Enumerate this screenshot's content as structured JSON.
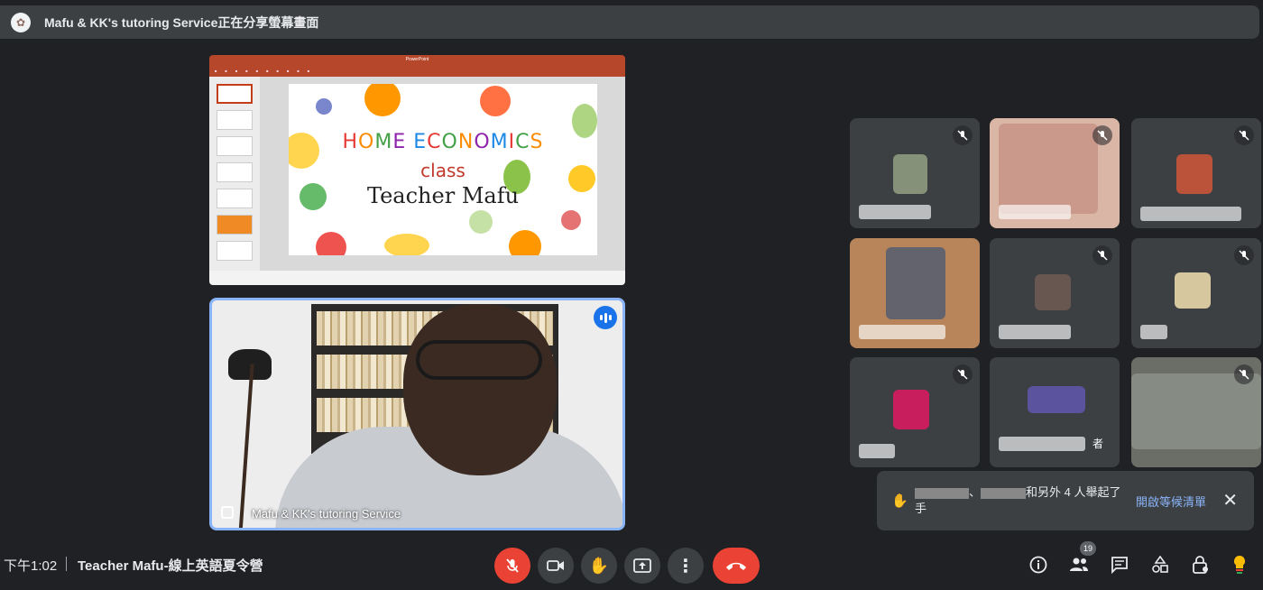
{
  "banner": {
    "text": "Mafu & KK's tutoring Service正在分享螢幕畫面"
  },
  "presentation": {
    "title_letters": [
      {
        "ch": "H",
        "color": "#e53935"
      },
      {
        "ch": "O",
        "color": "#fb8c00"
      },
      {
        "ch": "M",
        "color": "#43a047"
      },
      {
        "ch": "E",
        "color": "#8e24aa"
      },
      {
        "ch": " ",
        "color": "#000"
      },
      {
        "ch": "E",
        "color": "#1e88e5"
      },
      {
        "ch": "C",
        "color": "#e53935"
      },
      {
        "ch": "O",
        "color": "#43a047"
      },
      {
        "ch": "N",
        "color": "#fb8c00"
      },
      {
        "ch": "O",
        "color": "#8e24aa"
      },
      {
        "ch": "M",
        "color": "#1e88e5"
      },
      {
        "ch": "I",
        "color": "#e53935"
      },
      {
        "ch": "C",
        "color": "#43a047"
      },
      {
        "ch": "S",
        "color": "#fb8c00"
      }
    ],
    "subtitle": "class",
    "teacher": "Teacher Mafu"
  },
  "presenter": {
    "name": "Mafu & KK's tutoring Service"
  },
  "notification": {
    "text": "和另外 4 人舉起了手",
    "action": "開啟等候清單",
    "close": "✕"
  },
  "bottom": {
    "time": "下午1:02",
    "meeting_title": "Teacher Mafu-線上英語夏令營",
    "participants_badge": "19"
  },
  "tiles": [
    {
      "name": "",
      "muted": true
    },
    {
      "name": "",
      "muted": true
    },
    {
      "name": "",
      "muted": true
    },
    {
      "name": "",
      "muted": true
    },
    {
      "name": "",
      "muted": true
    },
    {
      "name": "",
      "muted": true
    },
    {
      "name": "",
      "muted": true
    },
    {
      "name": "者",
      "muted": true
    },
    {
      "name": "",
      "muted": true
    }
  ],
  "colors": {
    "accent": "#8ab4f8",
    "danger": "#ea4335",
    "bar": "#3c4043"
  }
}
